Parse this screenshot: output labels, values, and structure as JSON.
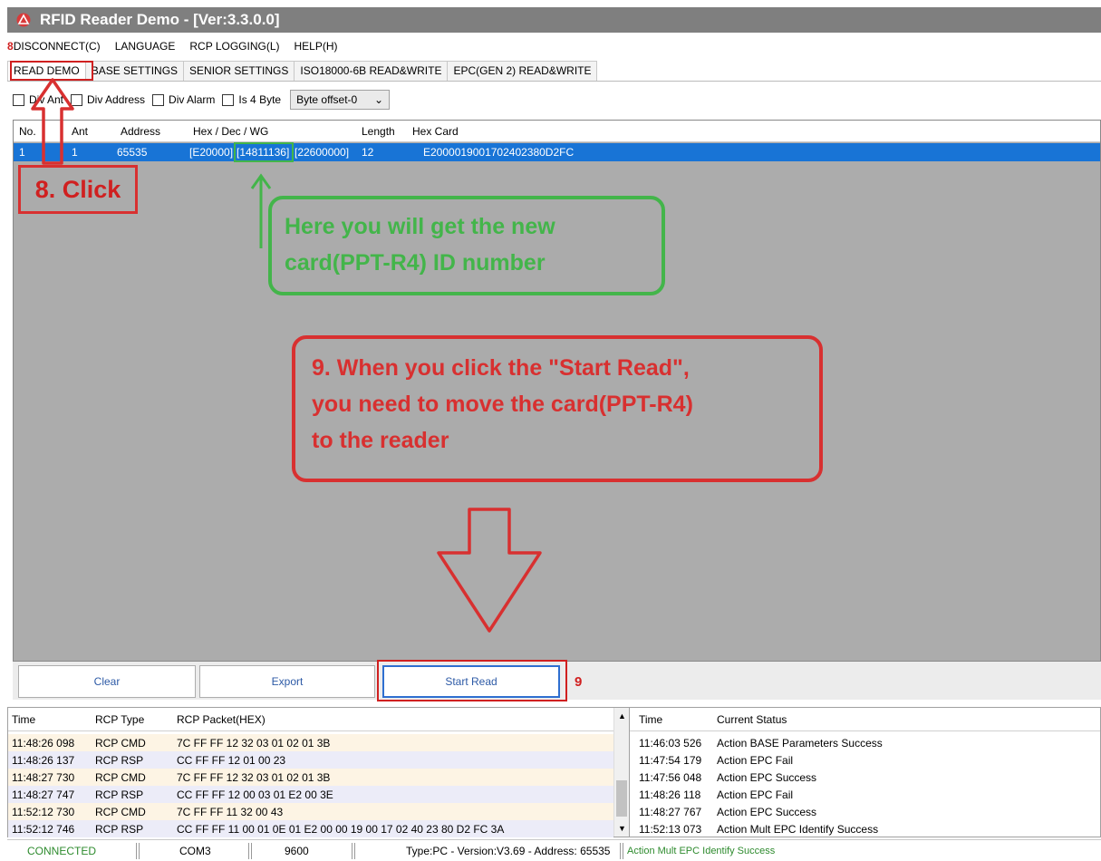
{
  "window": {
    "title": "RFID Reader Demo - [Ver:3.3.0.0]"
  },
  "colors": {
    "title_bar": "#7f7f7f",
    "selection": "#1874d6",
    "annotation_red": "#d83030",
    "annotation_green": "#43b54a",
    "status_ok": "#2e8b2e"
  },
  "menu": {
    "step": "8",
    "items": [
      "DISCONNECT(C)",
      "LANGUAGE",
      "RCP LOGGING(L)",
      "HELP(H)"
    ]
  },
  "tabs": [
    "READ DEMO",
    "BASE SETTINGS",
    "SENIOR SETTINGS",
    "ISO18000-6B READ&WRITE",
    "EPC(GEN 2) READ&WRITE"
  ],
  "options": {
    "div_ant": "Div Ant",
    "div_address": "Div Address",
    "div_alarm": "Div Alarm",
    "is4byte": "Is 4 Byte",
    "byte_offset": "Byte offset-0"
  },
  "grid": {
    "columns": [
      "No.",
      "Ant",
      "Address",
      "Hex / Dec / WG",
      "Length",
      "Hex Card"
    ],
    "rows": [
      {
        "no": "1",
        "ant": "1",
        "address": "65535",
        "hex": "[E20000]",
        "dec": "[14811136]",
        "wg": "[22600000]",
        "length": "12",
        "card": "E2000019001702402380D2FC"
      }
    ]
  },
  "annotations": {
    "click": "8. Click",
    "green_callout": [
      "Here you will get the new",
      "card(PPT-R4) ID number"
    ],
    "red_callout": [
      "9. When you click the \"Start Read\",",
      "you need to move the card(PPT-R4)",
      "to the reader"
    ],
    "step9": "9"
  },
  "buttons": {
    "clear": "Clear",
    "export": "Export",
    "start_read": "Start Read"
  },
  "log": {
    "columns": [
      "Time",
      "RCP Type",
      "RCP Packet(HEX)"
    ],
    "rows": [
      {
        "time": "11:48:26 098",
        "type": "RCP CMD",
        "packet": "7C FF FF 12 32 03 01 02 01 3B"
      },
      {
        "time": "11:48:26 137",
        "type": "RCP RSP",
        "packet": "CC FF FF 12 01 00 23"
      },
      {
        "time": "11:48:27 730",
        "type": "RCP CMD",
        "packet": "7C FF FF 12 32 03 01 02 01 3B"
      },
      {
        "time": "11:48:27 747",
        "type": "RCP RSP",
        "packet": "CC FF FF 12 00 03 01 E2 00 3E"
      },
      {
        "time": "11:52:12 730",
        "type": "RCP CMD",
        "packet": "7C FF FF 11 32 00 43"
      },
      {
        "time": "11:52:12 746",
        "type": "RCP RSP",
        "packet": "CC FF FF 11 00 01 0E 01 E2 00 00 19 00 17 02 40 23 80 D2 FC 3A"
      }
    ]
  },
  "status": {
    "columns": [
      "Time",
      "Current Status"
    ],
    "rows": [
      {
        "time": "11:46:03 526",
        "status": "Action BASE Parameters Success"
      },
      {
        "time": "11:47:54 179",
        "status": "Action EPC Fail"
      },
      {
        "time": "11:47:56 048",
        "status": "Action EPC Success"
      },
      {
        "time": "11:48:26 118",
        "status": "Action EPC Fail"
      },
      {
        "time": "11:48:27 767",
        "status": "Action EPC Success"
      },
      {
        "time": "11:52:13 073",
        "status": "Action Mult EPC Identify Success"
      }
    ]
  },
  "statusbar": {
    "connection": "CONNECTED",
    "port": "COM3",
    "baud": "9600",
    "info": "Type:PC - Version:V3.69 - Address: 65535",
    "message": "Action Mult EPC Identify Success"
  }
}
